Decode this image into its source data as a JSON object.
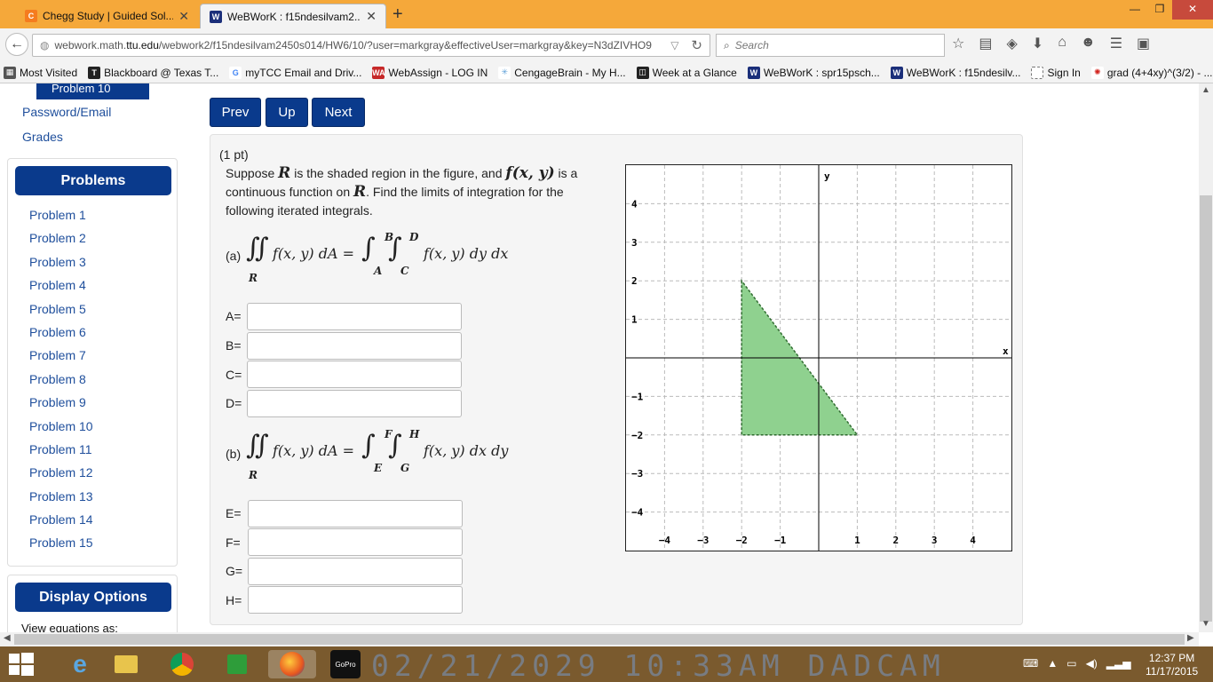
{
  "browser": {
    "tabs": [
      {
        "title": "Chegg Study | Guided Sol...",
        "icon": "chegg-icon",
        "color": "#f57c1f"
      },
      {
        "title": "WeBWorK : f15ndesilvam2...",
        "icon": "webwork-icon",
        "color": "#1b2f7a"
      }
    ],
    "url_prefix": "webwork.math.",
    "url_host": "ttu.edu",
    "url_rest": "/webwork2/f15ndesilvam2450s014/HW6/10/?user=markgray&effectiveUser=markgray&key=N3dZIVHO9",
    "search_placeholder": "Search",
    "bookmarks": [
      {
        "label": "Most Visited",
        "color": "#555"
      },
      {
        "label": "Blackboard @ Texas T...",
        "color": "#222"
      },
      {
        "label": "myTCC Email and Driv...",
        "color": "#fff"
      },
      {
        "label": "WebAssign - LOG IN",
        "color": "#c62828"
      },
      {
        "label": "CengageBrain - My H...",
        "color": "#5fa0d8"
      },
      {
        "label": "Week at a Glance",
        "color": "#222"
      },
      {
        "label": "WeBWorK : spr15psch...",
        "color": "#1b2f7a"
      },
      {
        "label": "WeBWorK : f15ndesilv...",
        "color": "#1b2f7a"
      },
      {
        "label": "Sign In",
        "color": "#fff"
      },
      {
        "label": "grad (4+4xy)^(3/2) - ...",
        "color": "#d2231d"
      }
    ]
  },
  "sidebar": {
    "current_problem": "Problem 10",
    "links": [
      "Password/Email",
      "Grades"
    ],
    "problems_header": "Problems",
    "problems": [
      "Problem 1",
      "Problem 2",
      "Problem 3",
      "Problem 4",
      "Problem 5",
      "Problem 6",
      "Problem 7",
      "Problem 8",
      "Problem 9",
      "Problem 10",
      "Problem 11",
      "Problem 12",
      "Problem 13",
      "Problem 14",
      "Problem 15"
    ],
    "display_header": "Display Options",
    "view_equations": "View equations as:"
  },
  "nav": {
    "prev": "Prev",
    "up": "Up",
    "next": "Next"
  },
  "problem": {
    "points": "(1 pt)",
    "statement_1": "Suppose ",
    "statement_R": "R",
    "statement_2": " is the shaded region in the figure, and ",
    "statement_f": "f(x, y)",
    "statement_3": " is a continuous function on ",
    "statement_4": ". Find the limits of integration for the following iterated integrals.",
    "part_a": "(a)",
    "part_b": "(b)",
    "integrand_left": "f(x, y) dA =",
    "integrand_a": "f(x, y) dy dx",
    "integrand_b": "f(x, y) dx dy",
    "region": "R",
    "limits_a": {
      "A": "A",
      "B": "B",
      "C": "C",
      "D": "D"
    },
    "limits_b": {
      "E": "E",
      "F": "F",
      "G": "G",
      "H": "H"
    },
    "fields_a": [
      "A=",
      "B=",
      "C=",
      "D="
    ],
    "fields_b": [
      "E=",
      "F=",
      "G=",
      "H="
    ]
  },
  "graph": {
    "xlabel": "x",
    "ylabel": "y",
    "xlim": [
      -5,
      5
    ],
    "ylim": [
      -5,
      5
    ],
    "xticks": [
      -4,
      -3,
      -2,
      -1,
      1,
      2,
      3,
      4
    ],
    "yticks": [
      4,
      3,
      2,
      1,
      -1,
      -2,
      -3,
      -4
    ],
    "region_vertices": [
      [
        -2,
        2
      ],
      [
        -2,
        -2
      ],
      [
        1,
        -2
      ]
    ],
    "fill_color": "#8fd18f",
    "stroke_color": "#2f6b2f"
  },
  "taskbar": {
    "overlay_text": "02/21/2029 10:33AM DADCAM",
    "time": "12:37 PM",
    "date": "11/17/2015"
  }
}
